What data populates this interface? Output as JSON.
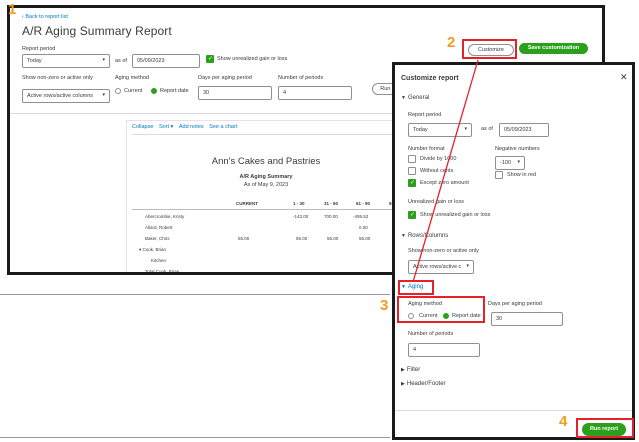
{
  "report": {
    "back_link": "Back to report list",
    "title": "A/R Aging Summary Report",
    "report_period_label": "Report period",
    "period_value": "Today",
    "as_of_label": "as of",
    "as_of_date": "05/09/2023",
    "unrealized_label": "Show unrealized gain or loss",
    "nonzero_label": "Show non-zero or active only",
    "nonzero_value": "Active rows/active columns",
    "aging_method_label": "Aging method",
    "aging_current": "Current",
    "aging_report_date": "Report date",
    "days_label": "Days per aging period",
    "days_value": "30",
    "periods_label": "Number of periods",
    "periods_value": "4",
    "run_label": "Run r",
    "customize_label": "Customize",
    "save_label": "Save customization",
    "toolbar": {
      "collapse": "Collapse",
      "sort": "Sort",
      "add_notes": "Add notes",
      "see_chart": "See a chart"
    },
    "company": "Ann's Cakes and Pastries",
    "report_name": "A/R Aging Summary",
    "report_date": "As of May 9, 2023",
    "columns": [
      "CURRENT",
      "1 - 30",
      "31 - 60",
      "61 - 90",
      "91"
    ],
    "rows": [
      {
        "name": "Abercrombie, Kristy",
        "current": "",
        "c1": "-143.00",
        "c2": "700.00",
        "c3": "-495.52"
      },
      {
        "name": "Allard, Robert",
        "current": "",
        "c1": "",
        "c2": "",
        "c3": "0.00"
      },
      {
        "name": "Baker, Chris",
        "current": "55.00",
        "c1": "55.00",
        "c2": "55.00",
        "c3": "55.00"
      },
      {
        "name": "Cook, Brian",
        "current": "",
        "c1": "",
        "c2": "",
        "c3": ""
      },
      {
        "name": "Kitchen",
        "current": "",
        "c1": "",
        "c2": "",
        "c3": ""
      },
      {
        "name": "Total Cook, Brian",
        "current": "",
        "c1": "",
        "c2": "",
        "c3": ""
      }
    ]
  },
  "panel": {
    "title": "Customize report",
    "close_icon": "close-icon",
    "general": "General",
    "report_period_label": "Report period",
    "period_value": "Today",
    "as_of_label": "as of",
    "as_of_date": "05/09/2023",
    "number_format_label": "Number format",
    "divide_label": "Divide by 1000",
    "without_cents_label": "Without cents",
    "except_zero_label": "Except zero amount",
    "negative_label": "Negative numbers",
    "negative_value": "-100",
    "show_red_label": "Show in red",
    "unrealized_label": "Unrealized gain or loss",
    "unrealized_check_label": "Show unrealized gain or loss",
    "rows_columns": "Rows/Columns",
    "nonzero_label": "Show non-zero or active only",
    "nonzero_value": "Active rows/active c",
    "aging": "Aging",
    "aging_method_label": "Aging method",
    "aging_current": "Current",
    "aging_report_date": "Report date",
    "days_label": "Days per aging period",
    "days_value": "30",
    "periods_label": "Number of periods",
    "periods_value": "4",
    "filter": "Filter",
    "header_footer": "Header/Footer",
    "run_label": "Run report"
  },
  "badges": [
    "1",
    "2",
    "3",
    "4"
  ],
  "colors": {
    "accent_green": "#2ca01c",
    "highlight_red": "#e8202a",
    "badge_orange": "#f39c22",
    "link_blue": "#0077c5"
  }
}
